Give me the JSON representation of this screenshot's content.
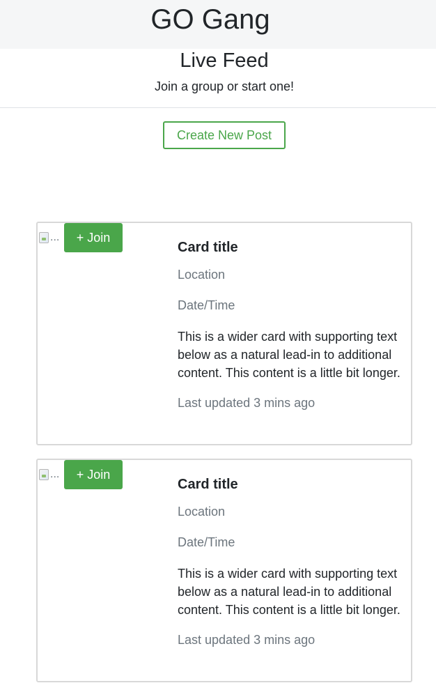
{
  "header": {
    "brand": "GO Gang"
  },
  "feed": {
    "title": "Live Feed",
    "subtitle": "Join a group or start one!",
    "create_button_label": "Create New Post"
  },
  "cards": [
    {
      "image_alt": "...",
      "join_label": "+ Join",
      "title": "Card title",
      "location": "Location",
      "datetime": "Date/Time",
      "text": "This is a wider card with supporting text below as a natural lead-in to additional content. This content is a little bit longer.",
      "updated": "Last updated 3 mins ago"
    },
    {
      "image_alt": "...",
      "join_label": "+ Join",
      "title": "Card title",
      "location": "Location",
      "datetime": "Date/Time",
      "text": "This is a wider card with supporting text below as a natural lead-in to additional content. This content is a little bit longer.",
      "updated": "Last updated 3 mins ago"
    }
  ],
  "colors": {
    "accent_green": "#4aa64a",
    "header_bg": "#f5f6f7",
    "muted_text": "#6c757d",
    "card_border": "#d8d8d8"
  },
  "icons": {
    "broken_image": "broken-image-icon"
  }
}
